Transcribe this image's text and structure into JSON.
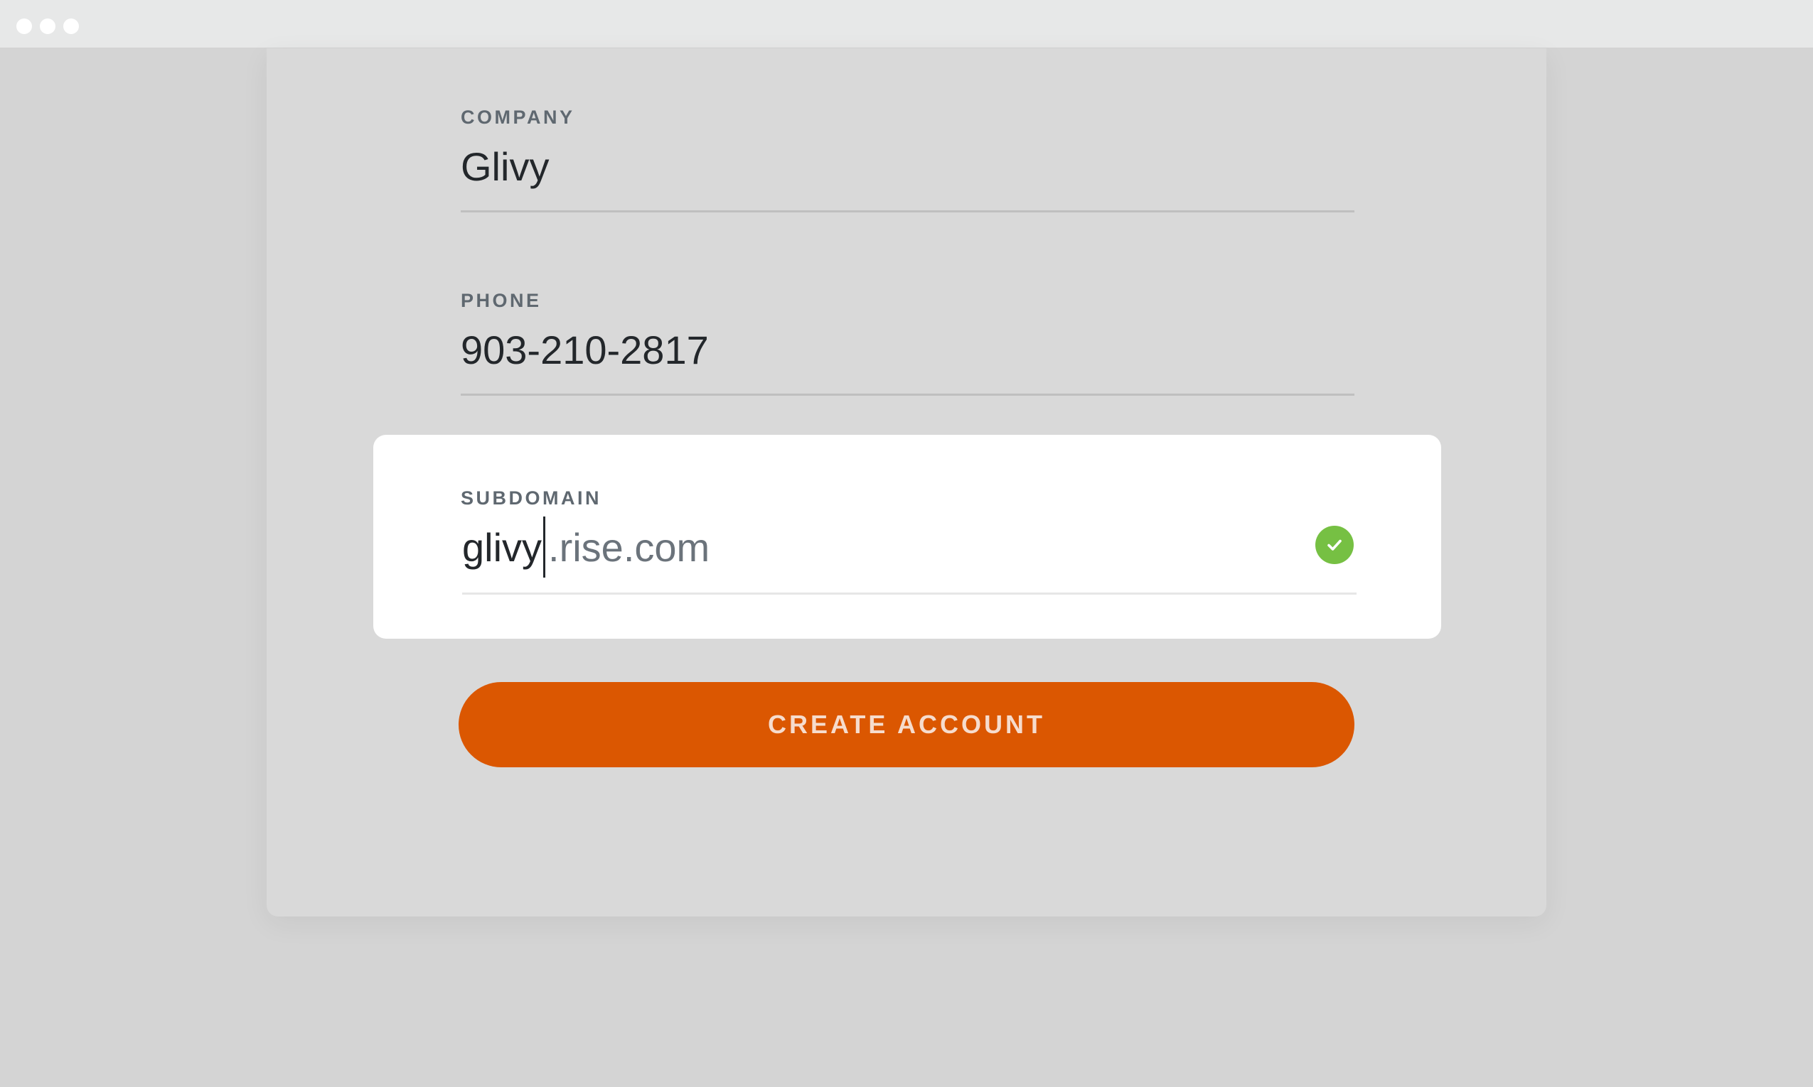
{
  "window": {
    "controls": [
      "close",
      "minimize",
      "maximize"
    ]
  },
  "form": {
    "company": {
      "label": "COMPANY",
      "value": "Glivy"
    },
    "phone": {
      "label": "PHONE",
      "value": "903-210-2817"
    },
    "subdomain": {
      "label": "SUBDOMAIN",
      "value": "glivy",
      "suffix": ".rise.com",
      "status_icon": "check-circle-icon",
      "status_color": "#76c043"
    },
    "submit": {
      "label": "CREATE ACCOUNT",
      "color": "#db5701"
    }
  }
}
